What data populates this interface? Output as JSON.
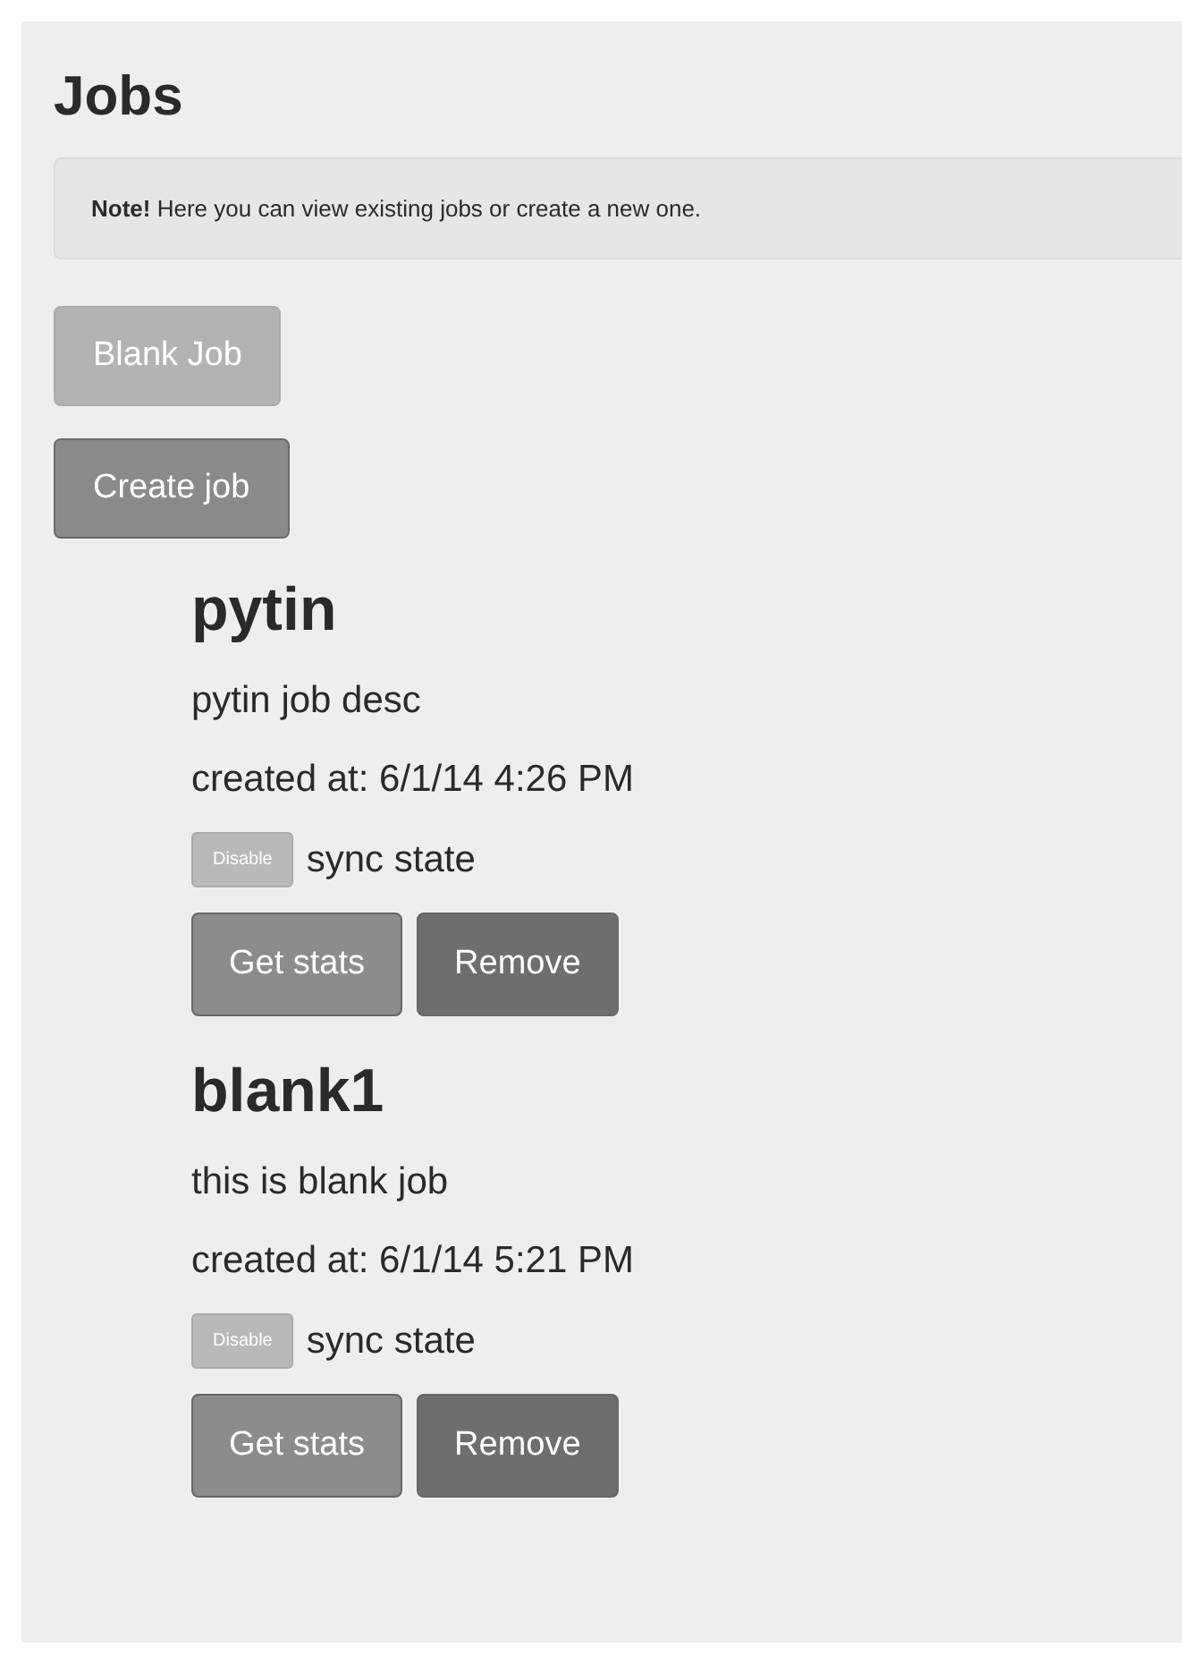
{
  "page": {
    "title": "Jobs"
  },
  "note": {
    "lead": "Note!",
    "text": "Here you can view existing jobs or create a new one."
  },
  "actions": [
    {
      "label": "Blank Job",
      "disabled": true
    },
    {
      "label": "Create job",
      "disabled": false
    }
  ],
  "jobs": [
    {
      "name": "pytin",
      "description": "pytin job desc",
      "created": "created at: 6/1/14 4:26 PM",
      "toggle": "Disable",
      "sync": "sync state",
      "buttons": [
        {
          "label": "Get stats",
          "kind": "stats"
        },
        {
          "label": "Remove",
          "kind": "remove"
        }
      ]
    },
    {
      "name": "blank1",
      "description": "this is blank job",
      "created": "created at: 6/1/14 5:21 PM",
      "toggle": "Disable",
      "sync": "sync state",
      "buttons": [
        {
          "label": "Get stats",
          "kind": "stats"
        },
        {
          "label": "Remove",
          "kind": "remove"
        }
      ]
    }
  ]
}
